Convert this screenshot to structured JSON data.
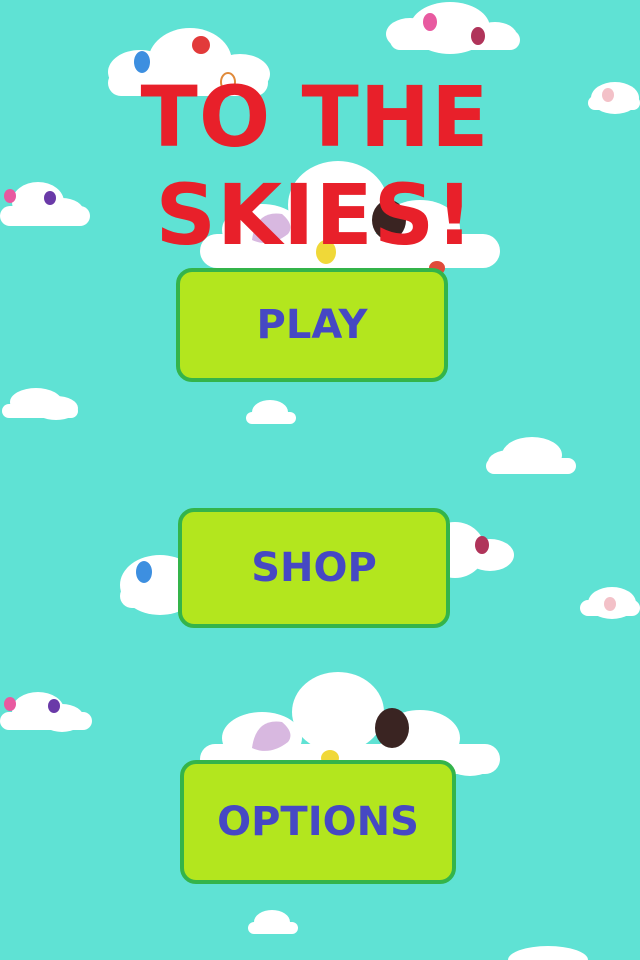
{
  "game": {
    "title": "TO THE SKIES!"
  },
  "menu": {
    "play_label": "PLAY",
    "shop_label": "SHOP",
    "options_label": "OPTIONS"
  },
  "colors": {
    "sky": "#5fe2d4",
    "title": "#e8202a",
    "button_fill": "#b3e61e",
    "button_border": "#34b44a",
    "button_text": "#4648c4",
    "cloud": "#ffffff"
  }
}
